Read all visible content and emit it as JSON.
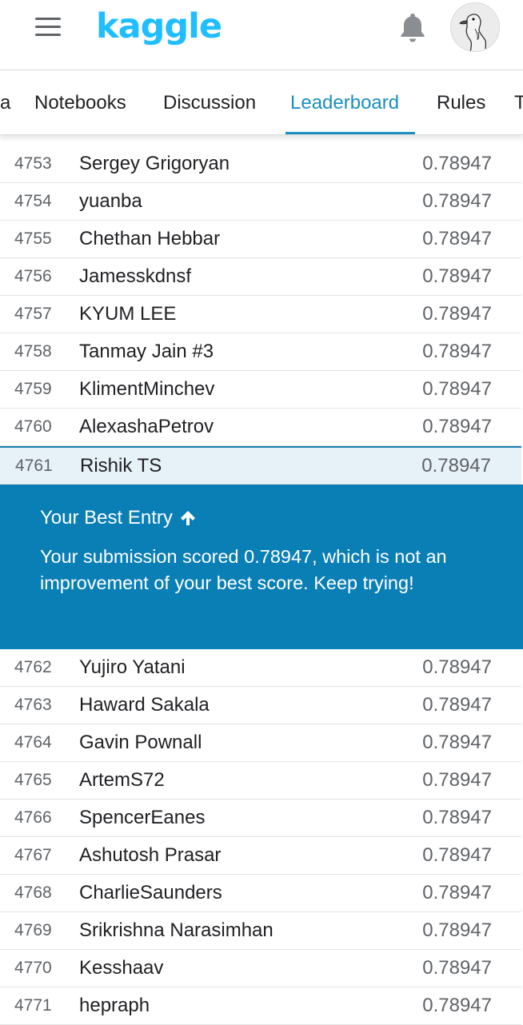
{
  "app": {
    "logo": "kaggle"
  },
  "tabs": [
    {
      "label": "a"
    },
    {
      "label": "Notebooks"
    },
    {
      "label": "Discussion"
    },
    {
      "label": "Leaderboard",
      "active": true
    },
    {
      "label": "Rules"
    },
    {
      "label": "T"
    }
  ],
  "rows_before": [
    {
      "rank": "4753",
      "name": "Sergey Grigoryan",
      "score": "0.78947"
    },
    {
      "rank": "4754",
      "name": "yuanba",
      "score": "0.78947"
    },
    {
      "rank": "4755",
      "name": "Chethan Hebbar",
      "score": "0.78947"
    },
    {
      "rank": "4756",
      "name": "Jamesskdnsf",
      "score": "0.78947"
    },
    {
      "rank": "4757",
      "name": "KYUM LEE",
      "score": "0.78947"
    },
    {
      "rank": "4758",
      "name": "Tanmay Jain #3",
      "score": "0.78947"
    },
    {
      "rank": "4759",
      "name": "KlimentMinchev",
      "score": "0.78947"
    },
    {
      "rank": "4760",
      "name": "AlexashaPetrov",
      "score": "0.78947"
    }
  ],
  "my_row": {
    "rank": "4761",
    "name": "Rishik TS",
    "score": "0.78947"
  },
  "banner": {
    "title": "Your Best Entry",
    "message": "Your submission scored 0.78947, which is not an improvement of your best score. Keep trying!"
  },
  "rows_after": [
    {
      "rank": "4762",
      "name": "Yujiro Yatani",
      "score": "0.78947"
    },
    {
      "rank": "4763",
      "name": "Haward Sakala",
      "score": "0.78947"
    },
    {
      "rank": "4764",
      "name": "Gavin Pownall",
      "score": "0.78947"
    },
    {
      "rank": "4765",
      "name": "ArtemS72",
      "score": "0.78947"
    },
    {
      "rank": "4766",
      "name": "SpencerEanes",
      "score": "0.78947"
    },
    {
      "rank": "4767",
      "name": "Ashutosh Prasar",
      "score": "0.78947"
    },
    {
      "rank": "4768",
      "name": "CharlieSaunders",
      "score": "0.78947"
    },
    {
      "rank": "4769",
      "name": "Srikrishna Narasimhan",
      "score": "0.78947"
    },
    {
      "rank": "4770",
      "name": "Kesshaav",
      "score": "0.78947"
    },
    {
      "rank": "4771",
      "name": "hepraph",
      "score": "0.78947"
    }
  ],
  "colors": {
    "accent": "#20beff",
    "tab_active": "#1a8fbd",
    "banner_bg": "#0a7fb6",
    "highlight_row": "#e7f1f8"
  }
}
